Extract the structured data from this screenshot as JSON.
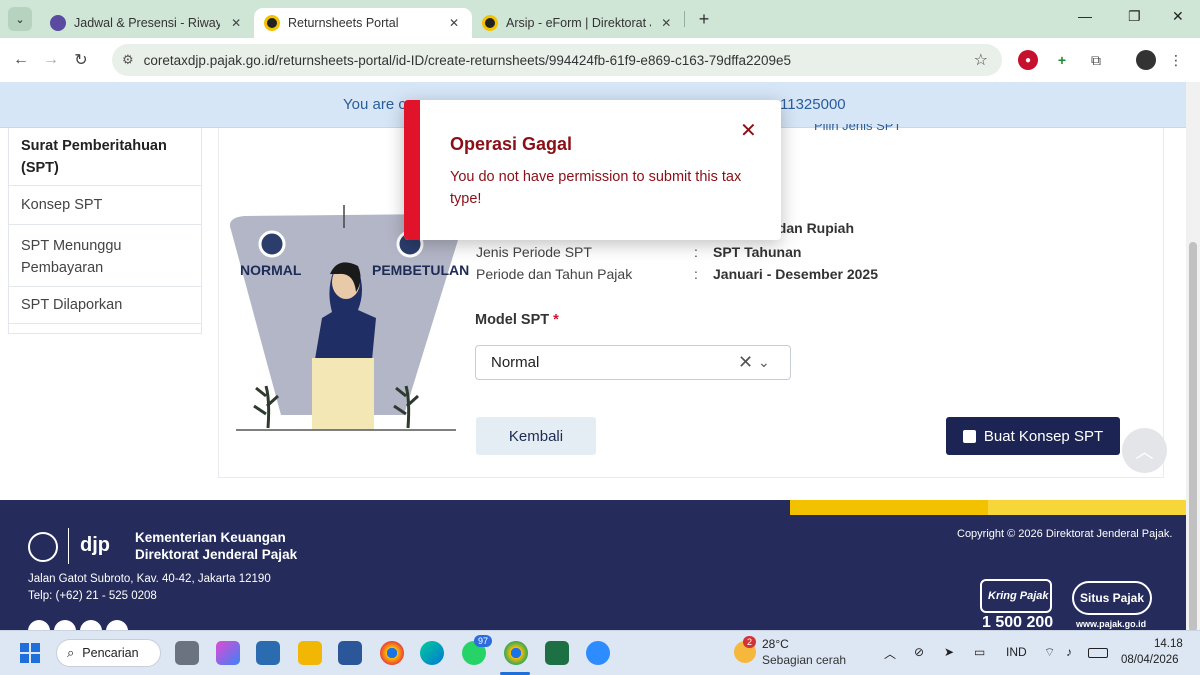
{
  "browser": {
    "tabs": [
      {
        "title": "Jadwal & Presensi - Riwayat da",
        "active": false,
        "fav_color": "#5a4aa0"
      },
      {
        "title": "Returnsheets Portal",
        "active": true,
        "fav_color": "#f3c300"
      },
      {
        "title": "Arsip - eForm | Direktorat Jende",
        "active": false,
        "fav_color": "#f3c300"
      }
    ],
    "url": "coretaxdjp.pajak.go.id/returnsheets-portal/id-ID/create-returnsheets/994424fb-61f9-e869-c163-79dffa2209e5"
  },
  "banner": {
    "left_text": "You are c",
    "right_text": "11325000"
  },
  "sidebar": {
    "title": "Surat Pemberitahuan (SPT)",
    "items": [
      "Konsep SPT",
      "SPT Menunggu Pembayaran",
      "SPT Dilaporkan"
    ]
  },
  "illustration": {
    "label_left": "NORMAL",
    "label_right": "PEMBETULAN"
  },
  "form": {
    "partial_top_text": "Pilih Jenis SPT",
    "partial_value": "adan Rupiah",
    "rows": [
      {
        "label": "Jenis Periode SPT",
        "value": "SPT Tahunan"
      },
      {
        "label": "Periode dan Tahun Pajak",
        "value": "Januari - Desember 2025"
      }
    ],
    "model_label": "Model SPT",
    "required_mark": "*",
    "model_value": "Normal",
    "back_label": "Kembali",
    "create_label": "Buat Konsep SPT"
  },
  "modal": {
    "title": "Operasi Gagal",
    "message": "You do not have permission to submit this tax type!"
  },
  "footer": {
    "org_line1": "Kementerian Keuangan",
    "org_line2": "Direktorat Jenderal Pajak",
    "djp_logo": "djp",
    "address": "Jalan Gatot Subroto, Kav. 40-42, Jakarta 12190",
    "phone": "Telp: (+62) 21 - 525 0208",
    "copyright": "Copyright © 2026 Direktorat Jenderal Pajak.",
    "kring_logo": "Kring Pajak",
    "kring_number": "1 500 200",
    "situs_logo": "Situs Pajak",
    "situs_url": "www.pajak.go.id",
    "stripe_colors": [
      "#f2c200",
      "#f7d63a"
    ]
  },
  "taskbar": {
    "search_label": "Pencarian",
    "whatsapp_badge": "97",
    "weather_badge": "2",
    "temperature": "28°C",
    "weather_desc": "Sebagian cerah",
    "lang": "IND",
    "time": "14.18",
    "date": "08/04/2026"
  }
}
